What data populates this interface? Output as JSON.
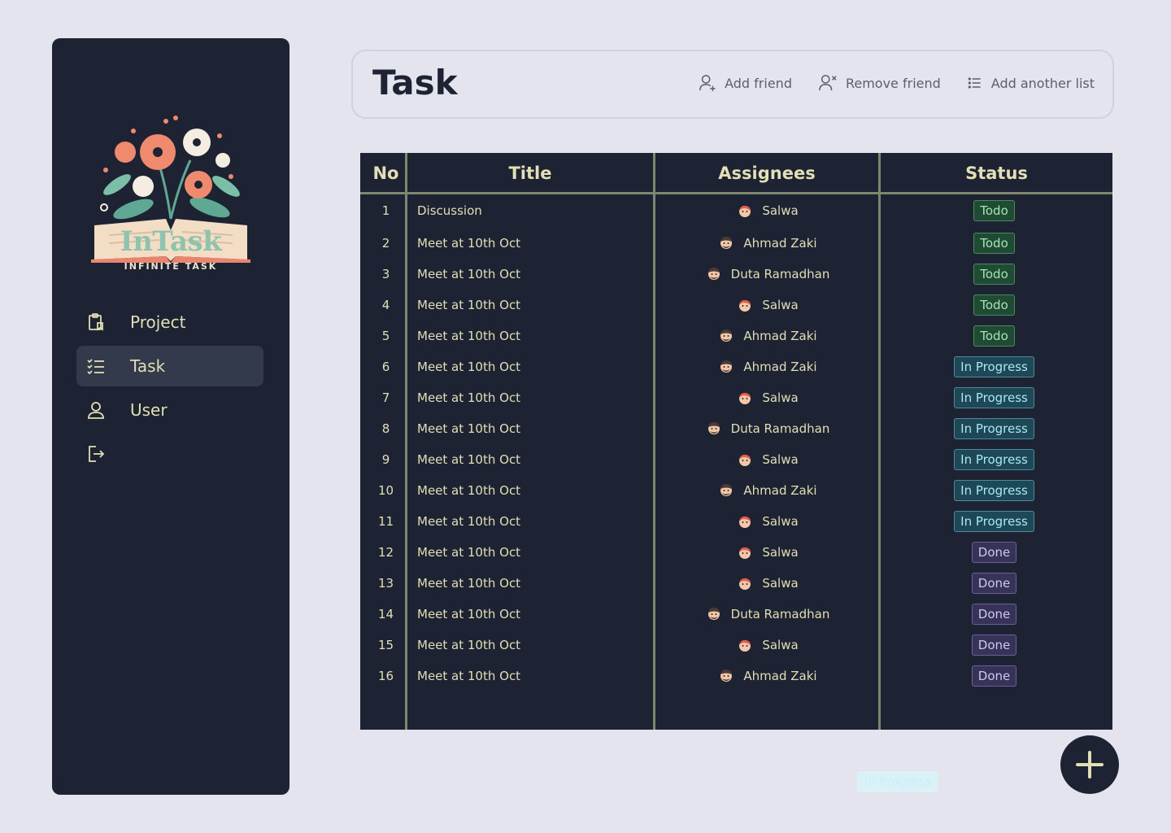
{
  "app": {
    "brand": "InTask",
    "tagline": "INFINITE TASK"
  },
  "sidebar": {
    "items": [
      {
        "label": "Project",
        "icon": "clipboard-icon"
      },
      {
        "label": "Task",
        "icon": "checklist-icon",
        "active": true
      },
      {
        "label": "User",
        "icon": "user-icon"
      },
      {
        "label": "",
        "icon": "logout-icon"
      }
    ]
  },
  "header": {
    "title": "Task",
    "actions": [
      {
        "label": "Add friend",
        "icon": "user-plus-icon"
      },
      {
        "label": "Remove friend",
        "icon": "user-x-icon"
      },
      {
        "label": "Add another list",
        "icon": "list-icon"
      }
    ]
  },
  "table": {
    "columns": [
      "No",
      "Title",
      "Assignees",
      "Status"
    ],
    "rows": [
      {
        "no": "1",
        "title": "Discussion",
        "assignee": "Salwa",
        "status": "Todo"
      },
      {
        "no": "2",
        "title": "Meet at 10th Oct",
        "assignee": "Ahmad Zaki",
        "status": "Todo"
      },
      {
        "no": "3",
        "title": "Meet at 10th Oct",
        "assignee": "Duta Ramadhan",
        "status": "Todo"
      },
      {
        "no": "4",
        "title": "Meet at 10th Oct",
        "assignee": "Salwa",
        "status": "Todo"
      },
      {
        "no": "5",
        "title": "Meet at 10th Oct",
        "assignee": "Ahmad Zaki",
        "status": "Todo"
      },
      {
        "no": "6",
        "title": "Meet at 10th Oct",
        "assignee": "Ahmad Zaki",
        "status": "In Progress"
      },
      {
        "no": "7",
        "title": "Meet at 10th Oct",
        "assignee": "Salwa",
        "status": "In Progress"
      },
      {
        "no": "8",
        "title": "Meet at 10th Oct",
        "assignee": "Duta Ramadhan",
        "status": "In Progress"
      },
      {
        "no": "9",
        "title": "Meet at 10th Oct",
        "assignee": "Salwa",
        "status": "In Progress"
      },
      {
        "no": "10",
        "title": "Meet at 10th Oct",
        "assignee": "Ahmad Zaki",
        "status": "In Progress"
      },
      {
        "no": "11",
        "title": "Meet at 10th Oct",
        "assignee": "Salwa",
        "status": "In Progress"
      },
      {
        "no": "12",
        "title": "Meet at 10th Oct",
        "assignee": "Salwa",
        "status": "Done"
      },
      {
        "no": "13",
        "title": "Meet at 10th Oct",
        "assignee": "Salwa",
        "status": "Done"
      },
      {
        "no": "14",
        "title": "Meet at 10th Oct",
        "assignee": "Duta Ramadhan",
        "status": "Done"
      },
      {
        "no": "15",
        "title": "Meet at 10th Oct",
        "assignee": "Salwa",
        "status": "Done"
      },
      {
        "no": "16",
        "title": "Meet at 10th Oct",
        "assignee": "Ahmad Zaki",
        "status": "Done"
      }
    ]
  },
  "fab": {
    "icon": "plus-icon"
  },
  "drag_ghost": {
    "label": "In Progress"
  },
  "colors": {
    "background": "#e3e4ee",
    "panel": "#1d2332",
    "accent_text": "#e2dfb6",
    "todo": "#a4e4b2",
    "in_progress": "#a9e7f6",
    "done": "#cfc7f1"
  }
}
